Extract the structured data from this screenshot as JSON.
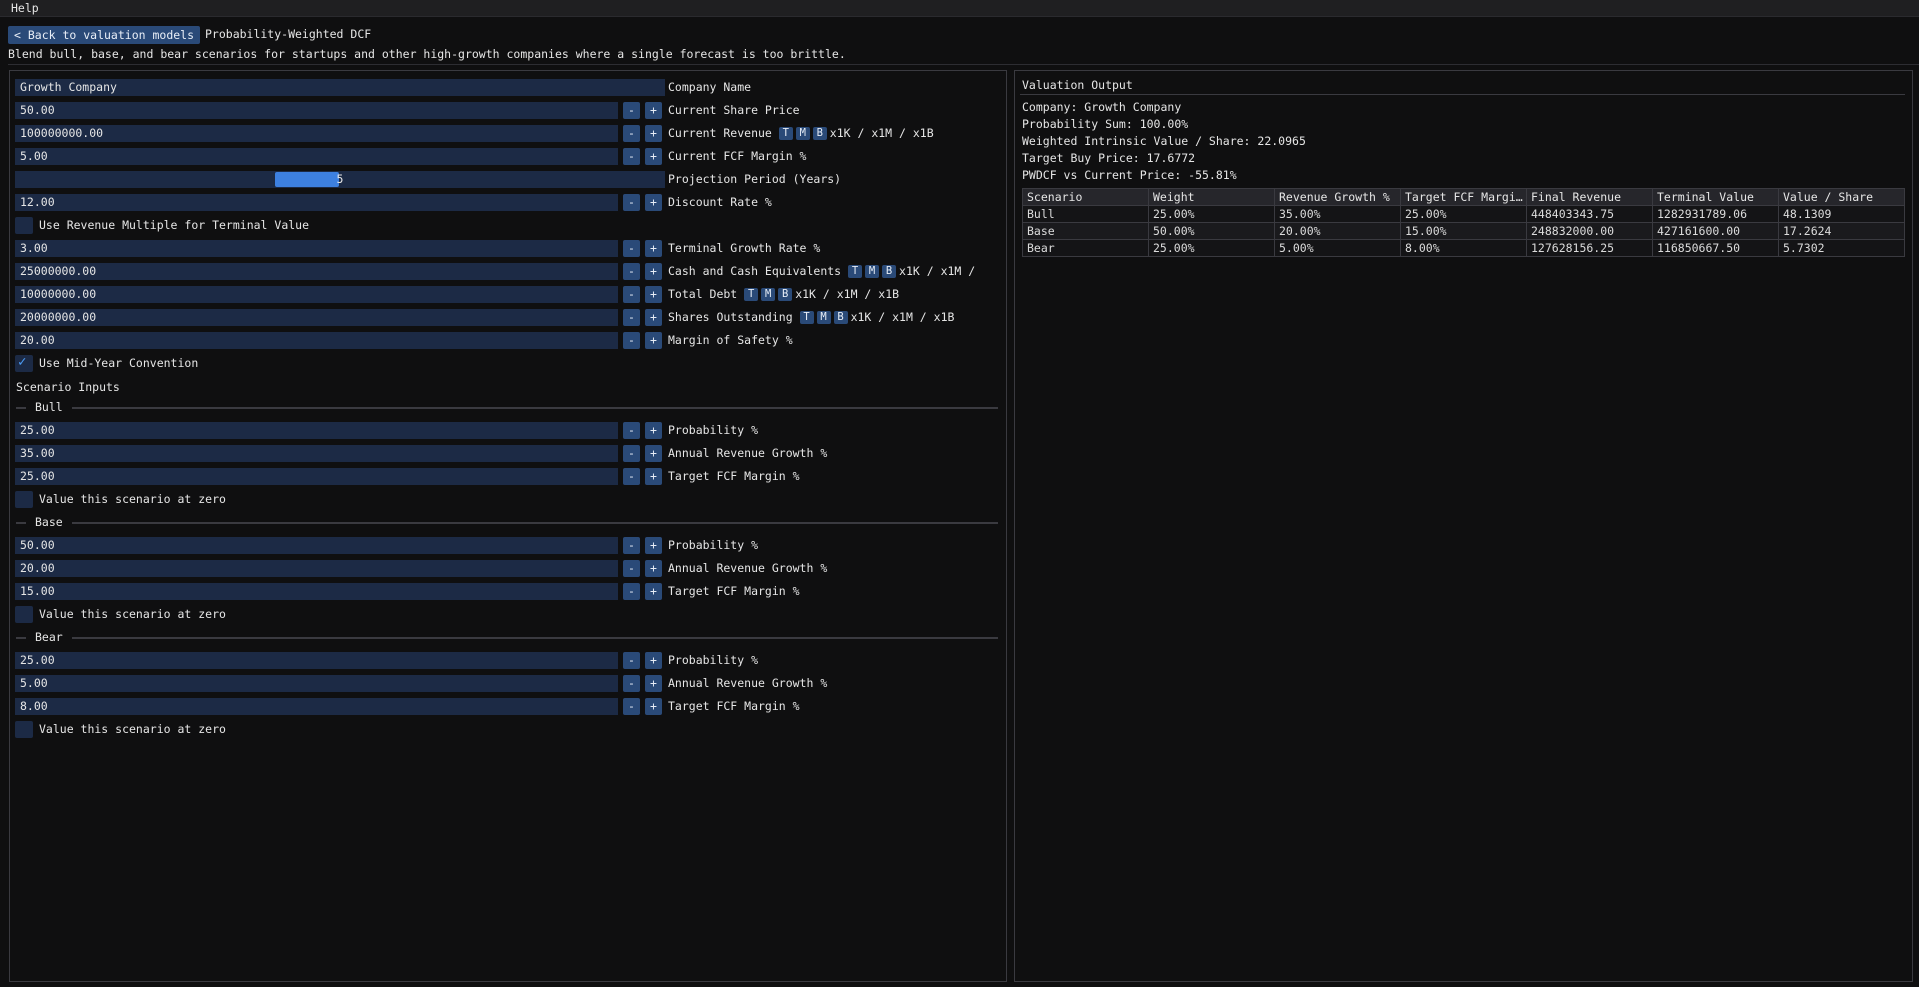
{
  "menubar": {
    "help": "Help"
  },
  "header": {
    "back_label": "< Back to valuation models",
    "title": "Probability-Weighted DCF",
    "description": "Blend bull, base, and bear scenarios for startups and other high-growth companies where a single forecast is too brittle."
  },
  "inputs": {
    "company_name": {
      "value": "Growth Company",
      "label": "Company Name"
    },
    "share_price": {
      "value": "50.00",
      "label": "Current Share Price"
    },
    "revenue": {
      "value": "100000000.00",
      "label": "Current Revenue",
      "suffix": "x1K / x1M / x1B"
    },
    "fcf_margin": {
      "value": "5.00",
      "label": "Current FCF Margin %"
    },
    "projection": {
      "value": "5",
      "label": "Projection Period (Years)",
      "min": 1,
      "max": 10
    },
    "discount_rate": {
      "value": "12.00",
      "label": "Discount Rate %"
    },
    "revenue_multiple": {
      "label": "Use Revenue Multiple for Terminal Value",
      "checked": false
    },
    "terminal_growth": {
      "value": "3.00",
      "label": "Terminal Growth Rate %"
    },
    "cash": {
      "value": "25000000.00",
      "label": "Cash and Cash Equivalents",
      "suffix": "x1K / x1M /"
    },
    "debt": {
      "value": "10000000.00",
      "label": "Total Debt",
      "suffix": "x1K / x1M / x1B"
    },
    "shares": {
      "value": "20000000.00",
      "label": "Shares Outstanding",
      "suffix": "x1K / x1M / x1B"
    },
    "margin_safety": {
      "value": "20.00",
      "label": "Margin of Safety %"
    },
    "mid_year": {
      "label": "Use Mid-Year Convention",
      "checked": true
    }
  },
  "chips": {
    "t": "T",
    "m": "M",
    "b": "B"
  },
  "steppers": {
    "minus": "-",
    "plus": "+"
  },
  "scenarios_heading": "Scenario Inputs",
  "scenarios": [
    {
      "name": "Bull",
      "probability": "25.00",
      "growth": "35.00",
      "margin": "25.00"
    },
    {
      "name": "Base",
      "probability": "50.00",
      "growth": "20.00",
      "margin": "15.00"
    },
    {
      "name": "Bear",
      "probability": "25.00",
      "growth": "5.00",
      "margin": "8.00"
    }
  ],
  "scenario_labels": {
    "probability": "Probability %",
    "growth": "Annual Revenue Growth %",
    "margin": "Target FCF Margin %",
    "zero": "Value this scenario at zero"
  },
  "output": {
    "heading": "Valuation Output",
    "lines": [
      "Company: Growth Company",
      "Probability Sum: 100.00%",
      "Weighted Intrinsic Value / Share: 22.0965",
      "Target Buy Price: 17.6772",
      "PWDCF vs Current Price: -55.81%"
    ],
    "table": {
      "headers": [
        "Scenario",
        "Weight",
        "Revenue Growth %",
        "Target FCF Margi…",
        "Final Revenue",
        "Terminal Value",
        "Value / Share"
      ],
      "rows": [
        [
          "Bull",
          "25.00%",
          "35.00%",
          "25.00%",
          "448403343.75",
          "1282931789.06",
          "48.1309"
        ],
        [
          "Base",
          "50.00%",
          "20.00%",
          "15.00%",
          "248832000.00",
          "427161600.00",
          "17.2624"
        ],
        [
          "Bear",
          "25.00%",
          "5.00%",
          "8.00%",
          "127628156.25",
          "116850667.50",
          "5.7302"
        ]
      ]
    }
  }
}
